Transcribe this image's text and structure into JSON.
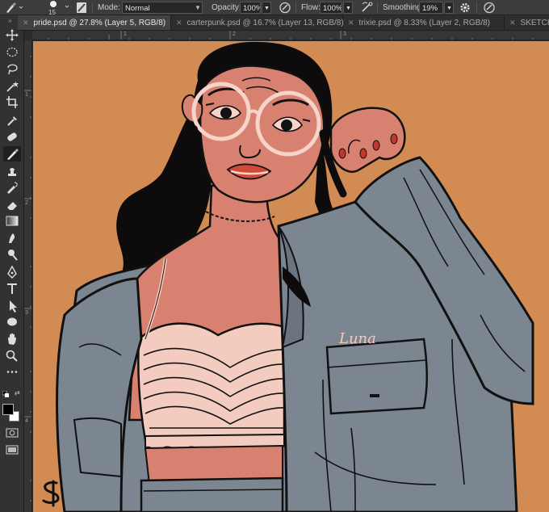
{
  "options_bar": {
    "brush_size": "15",
    "mode_label": "Mode:",
    "mode_value": "Normal",
    "opacity_label": "Opacity:",
    "opacity_value": "100%",
    "flow_label": "Flow:",
    "flow_value": "100%",
    "smoothing_label": "Smoothing:",
    "smoothing_value": "19%"
  },
  "tab_bar": {
    "expand": "»",
    "tabs": [
      {
        "label": "pride.psd @ 27.8% (Layer 5, RGB/8)",
        "active": true
      },
      {
        "label": "carterpunk.psd @ 16.7% (Layer 13, RGB/8)",
        "active": false
      },
      {
        "label": "trixie.psd @ 8.33% (Layer 2, RGB/8)",
        "active": false
      },
      {
        "label": "SKETCHY",
        "active": false
      }
    ]
  },
  "rulers": {
    "top": [
      "1",
      "2",
      "3"
    ],
    "left": [
      "1",
      "2",
      "3",
      "4"
    ]
  },
  "tools": [
    "move-icon",
    "marquee-icon",
    "lasso-icon",
    "magic-wand-icon",
    "crop-icon",
    "eyedropper-icon",
    "healing-brush-icon",
    "brush-icon",
    "clone-stamp-icon",
    "history-brush-icon",
    "eraser-icon",
    "gradient-icon",
    "smudge-icon",
    "dodge-icon",
    "pen-icon",
    "type-icon",
    "path-selection-icon",
    "shape-icon",
    "hand-icon",
    "zoom-icon",
    "more-tools-icon"
  ],
  "colors": {
    "canvas_bg": "#d38b54",
    "skin": "#d88171",
    "jacket": "#7b8691",
    "hair": "#0d0b0c",
    "top": "#f4cbbf",
    "glasses": "#f7d4ca",
    "foreground": "#000000",
    "background": "#ffffff"
  },
  "artwork": {
    "jacket_name": "Luna"
  }
}
